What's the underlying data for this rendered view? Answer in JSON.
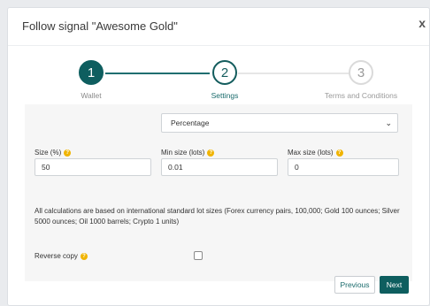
{
  "dialog": {
    "title": "Follow signal \"Awesome Gold\"",
    "close": "x"
  },
  "stepper": {
    "steps": [
      {
        "number": "1",
        "label": "Wallet",
        "state": "completed"
      },
      {
        "number": "2",
        "label": "Settings",
        "state": "active"
      },
      {
        "number": "3",
        "label": "Terms and Conditions",
        "state": "upcoming"
      }
    ]
  },
  "form": {
    "mode": {
      "selected": "Percentage"
    },
    "size": {
      "label": "Size (%)",
      "value": "50"
    },
    "min_size": {
      "label": "Min size (lots)",
      "value": "0.01"
    },
    "max_size": {
      "label": "Max size (lots)",
      "value": "0"
    },
    "note": "All calculations are based on international standard lot sizes (Forex currency pairs, 100,000; Gold 100 ounces; Silver 5000 ounces; Oil 1000 barrels; Crypto 1 units)",
    "reverse_copy": {
      "label": "Reverse copy",
      "checked": false
    }
  },
  "buttons": {
    "previous": "Previous",
    "next": "Next"
  },
  "colors": {
    "primary": "#0e5e5f",
    "help": "#f0b400",
    "panel": "#f6f6f6"
  }
}
